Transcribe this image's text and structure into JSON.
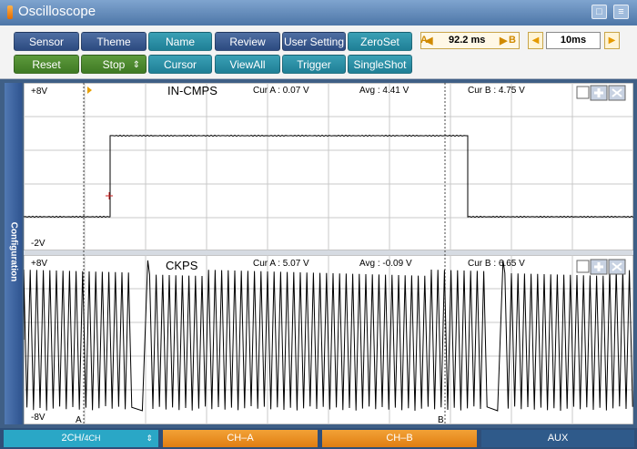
{
  "window": {
    "title": "Oscilloscope"
  },
  "toolbar": {
    "row1": [
      "Sensor",
      "Theme",
      "Name",
      "Review",
      "User Setting",
      "ZeroSet"
    ],
    "row2": [
      "Reset",
      "Stop",
      "Cursor",
      "ViewAll",
      "Trigger",
      "SingleShot"
    ],
    "cursor_a_label": "A",
    "cursor_delta": "92.2 ms",
    "cursor_b_label": "B",
    "time_div": "10ms"
  },
  "side_tab": {
    "label": "Configuration"
  },
  "channels": [
    {
      "name": "IN-CMPS",
      "ymax": "+8V",
      "ymin": "-2V",
      "cur_a": "Cur A : 0.07 V",
      "avg": "Avg : 4.41 V",
      "cur_b": "Cur B : 4.75 V"
    },
    {
      "name": "CKPS",
      "ymax": "+8V",
      "ymin": "-8V",
      "cur_a": "Cur A : 5.07 V",
      "avg": "Avg : -0.09 V",
      "cur_b": "Cur B : 6.65 V"
    }
  ],
  "cursor_markers": {
    "a": "A",
    "b": "B"
  },
  "bottom_tabs": {
    "channels_main": "2CH",
    "channels_sep": "/",
    "channels_alt": "4CH",
    "ch_a": "CH–A",
    "ch_b": "CH–B",
    "aux": "AUX"
  },
  "colors": {
    "accent_orange": "#e88a1a",
    "panel_blue": "#3f5f86",
    "trace": "#000000"
  }
}
